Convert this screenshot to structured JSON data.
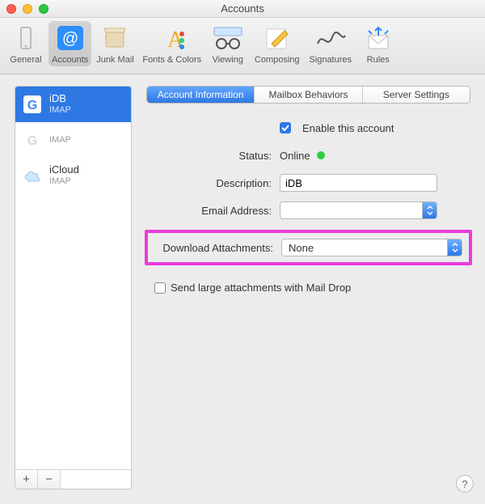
{
  "window": {
    "title": "Accounts"
  },
  "toolbar": [
    {
      "id": "general",
      "label": "General"
    },
    {
      "id": "accounts",
      "label": "Accounts"
    },
    {
      "id": "junk",
      "label": "Junk Mail"
    },
    {
      "id": "fonts",
      "label": "Fonts & Colors"
    },
    {
      "id": "viewing",
      "label": "Viewing"
    },
    {
      "id": "composing",
      "label": "Composing"
    },
    {
      "id": "signatures",
      "label": "Signatures"
    },
    {
      "id": "rules",
      "label": "Rules"
    }
  ],
  "accounts": [
    {
      "name": "iDB",
      "type": "IMAP",
      "provider": "google",
      "selected": true
    },
    {
      "name": "",
      "type": "IMAP",
      "provider": "google",
      "selected": false
    },
    {
      "name": "iCloud",
      "type": "IMAP",
      "provider": "icloud",
      "selected": false
    }
  ],
  "tabs": [
    {
      "label": "Account Information",
      "active": true
    },
    {
      "label": "Mailbox Behaviors",
      "active": false
    },
    {
      "label": "Server Settings",
      "active": false
    }
  ],
  "form": {
    "enable_label": "Enable this account",
    "enable_checked": true,
    "status_label": "Status:",
    "status_value": "Online",
    "description_label": "Description:",
    "description_value": "iDB",
    "email_label": "Email Address:",
    "email_value": "",
    "download_label": "Download Attachments:",
    "download_value": "None",
    "maildrop_label": "Send large attachments with Mail Drop",
    "maildrop_checked": false
  },
  "footer": {
    "add": "+",
    "remove": "−"
  }
}
